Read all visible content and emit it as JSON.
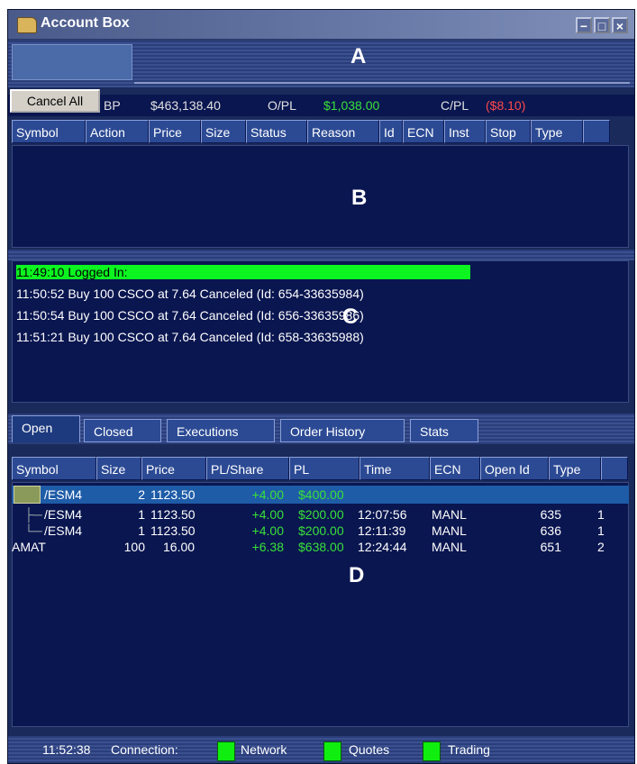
{
  "window": {
    "title": "Account Box"
  },
  "toolbar": {
    "cancel_all": "Cancel All"
  },
  "account": {
    "bp_label": "BP",
    "bp_value": "$463,138.40",
    "opl_label": "O/PL",
    "opl_value": "$1,038.00",
    "cpl_label": "C/PL",
    "cpl_value": "($8.10)"
  },
  "markers": {
    "a": "A",
    "b": "B",
    "c": "C",
    "d": "D"
  },
  "orders": {
    "columns": [
      "Symbol",
      "Action",
      "Price",
      "Size",
      "Status",
      "Reason",
      "Id",
      "ECN",
      "Inst",
      "Stop",
      "Type"
    ]
  },
  "log": {
    "lines": [
      "11:49:10 Logged In:",
      "11:50:52 Buy 100 CSCO at 7.64 Canceled (Id: 654-33635984)",
      "11:50:54 Buy 100 CSCO at 7.64 Canceled (Id: 656-33635986)",
      "11:51:21 Buy 100 CSCO at 7.64 Canceled (Id: 658-33635988)"
    ]
  },
  "tabs": [
    "Open",
    "Closed",
    "Executions",
    "Order History",
    "Stats"
  ],
  "positions": {
    "columns": [
      "Symbol",
      "Size",
      "Price",
      "PL/Share",
      "PL",
      "Time",
      "ECN",
      "Open Id",
      "Type"
    ],
    "rows": [
      {
        "symbol": "/ESM4",
        "size": "2",
        "price": "1123.50",
        "pl_share": "+4.00",
        "pl": "$400.00",
        "time": "",
        "ecn": "",
        "open_id": "",
        "type": ""
      },
      {
        "symbol": "/ESM4",
        "size": "1",
        "price": "1123.50",
        "pl_share": "+4.00",
        "pl": "$200.00",
        "time": "12:07:56",
        "ecn": "MANL",
        "open_id": "635",
        "type": "1"
      },
      {
        "symbol": "/ESM4",
        "size": "1",
        "price": "1123.50",
        "pl_share": "+4.00",
        "pl": "$200.00",
        "time": "12:11:39",
        "ecn": "MANL",
        "open_id": "636",
        "type": "1"
      },
      {
        "symbol": "AMAT",
        "size": "100",
        "price": "16.00",
        "pl_share": "+6.38",
        "pl": "$638.00",
        "time": "12:24:44",
        "ecn": "MANL",
        "open_id": "651",
        "type": "2"
      }
    ]
  },
  "status": {
    "time": "11:52:38",
    "connection_label": "Connection:",
    "network": "Network",
    "quotes": "Quotes",
    "trading": "Trading"
  },
  "colors": {
    "positive": "#39e039",
    "negative": "#ff4a4a",
    "indicator": "#10ee10",
    "highlight": "#0cf520"
  }
}
